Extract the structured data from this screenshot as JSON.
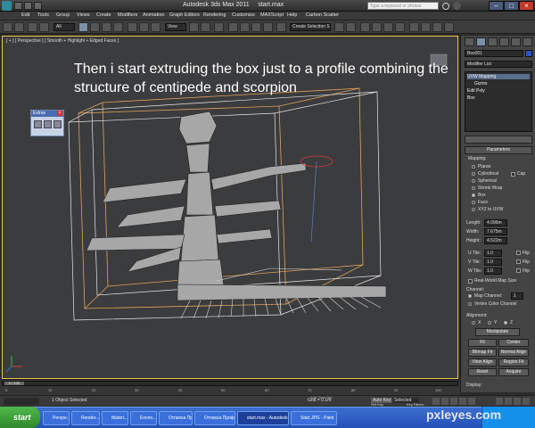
{
  "window": {
    "title": "Autodesk 3ds Max  2011",
    "file": "start.max",
    "search_placeholder": "Type a keyword or phrase"
  },
  "menu": [
    "Edit",
    "Tools",
    "Group",
    "Views",
    "Create",
    "Modifiers",
    "Animation",
    "Graph Editors",
    "Rendering",
    "Customize",
    "MAXScript",
    "Help",
    "Carbon Scatter"
  ],
  "toolbar": {
    "selection_filter": "All",
    "reference_coord": "View",
    "named_selection": "Create Selection Se"
  },
  "viewport": {
    "label": "[ + ] [ Perspective ] [ Smooth + Highlight + Edged Faces ]",
    "caption": "Then i start extruding the box just to  a profile combining the structure of centipede and scorpion"
  },
  "extras": {
    "title": "Extras"
  },
  "command_panel": {
    "object_name": "Box001",
    "modifier_list": "Modifier List",
    "stack": [
      "UVW Mapping",
      "Gizmo",
      "Edit Poly",
      "Box"
    ],
    "rollout": "Parameters",
    "mapping_label": "Mapping:",
    "mapping_options": [
      "Planar",
      "Cylindrical",
      "Spherical",
      "Shrink Wrap",
      "Box",
      "Face",
      "XYZ to UVW"
    ],
    "mapping_selected": "Box",
    "cap_label": "Cap",
    "length_label": "Length:",
    "length": "4.096m",
    "width_label": "Width:",
    "width": "7.675m",
    "height_label": "Height:",
    "height": "4.522m",
    "u_tile_label": "U Tile:",
    "u_tile": "1.0",
    "v_tile_label": "V Tile:",
    "v_tile": "1.0",
    "w_tile_label": "W Tile:",
    "w_tile": "1.0",
    "flip_label": "Flip",
    "real_world": "Real-World Map Size",
    "channel_label": "Channel:",
    "map_channel": "Map Channel:",
    "map_channel_value": "1",
    "vertex_color": "Vertex Color Channel",
    "alignment_label": "Alignment:",
    "axes": [
      "X",
      "Y",
      "Z"
    ],
    "manipulate": "Manipulate",
    "fit": "Fit",
    "center": "Center",
    "bitmap_fit": "Bitmap Fit",
    "normal_align": "Normal Align",
    "view_align": "View Align",
    "region_fit": "Region Fit",
    "reset": "Reset",
    "acquire": "Acquire",
    "display": "Display:"
  },
  "timeline": {
    "frame": "0 / 100",
    "ticks": [
      "0",
      "10",
      "20",
      "30",
      "40",
      "50",
      "60",
      "70",
      "80",
      "90",
      "100"
    ]
  },
  "status": {
    "selected": "1 Object Selected",
    "grid": "Grid = 0.1m",
    "auto_key": "Auto Key",
    "selected_filter": "Selected",
    "set_key": "Set Key",
    "key_filters": "Key Filters...",
    "add_time_tag": "Add Time Tag"
  },
  "taskbar": {
    "start": "start",
    "tasks": [
      "Perspe...",
      "Render...",
      "Materi...",
      "Enviro...",
      "Отписка Профи",
      "Отписка Профи 1.р...",
      "start.max - Autodesk...",
      "Start.JPG - Paint"
    ]
  },
  "watermark": "pxleyes.com",
  "colors": {
    "viewport_bg": "#3b3c3e",
    "model": "#b9b9b9",
    "bbox_orange": "#e1a35a",
    "gizmo_red": "#d23a3a",
    "taskbar_blue": "#2351b6"
  }
}
